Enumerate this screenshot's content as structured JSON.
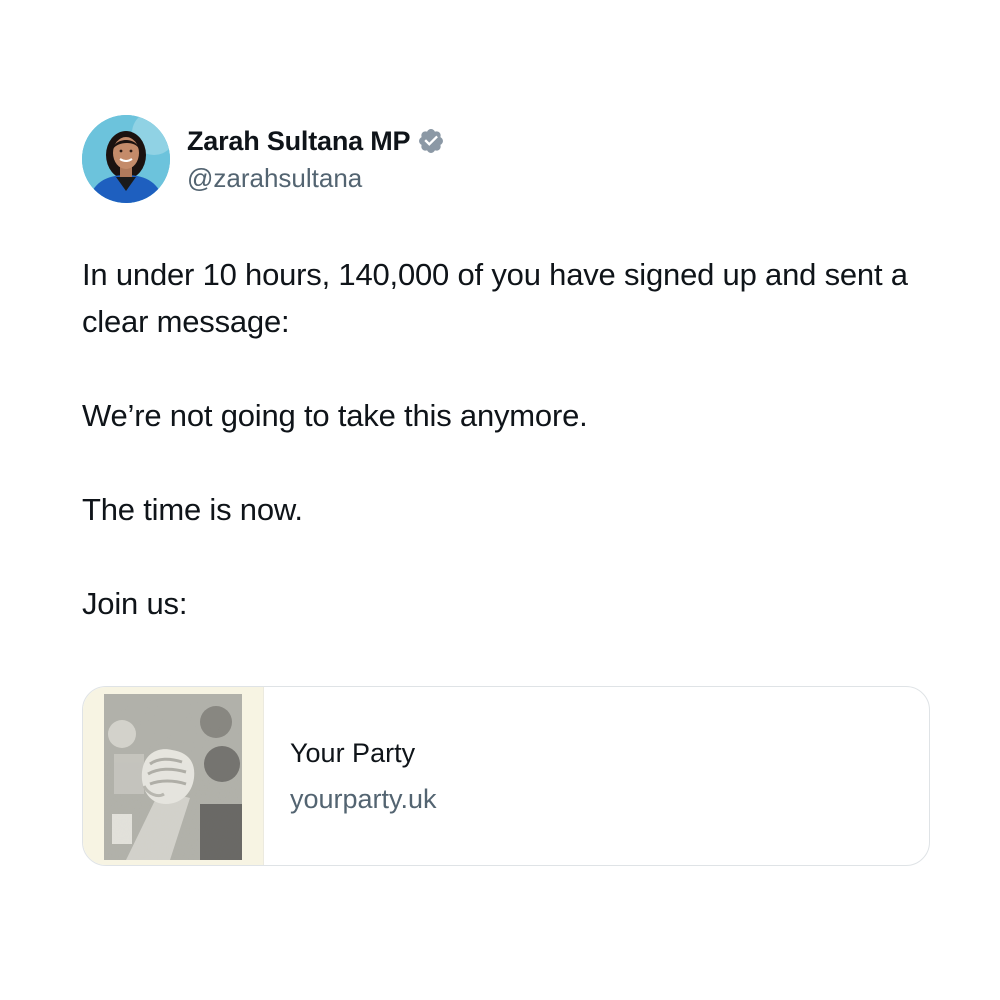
{
  "author": {
    "display_name": "Zarah Sultana MP",
    "handle": "@zarahsultana",
    "verified": true,
    "verified_icon": "verified-badge-icon",
    "verified_color": "#8b98a5"
  },
  "tweet": {
    "paragraphs": [
      "In under 10 hours, 140,000 of you have signed up and sent a clear message:",
      "We’re not going to take this anymore.",
      "The time is now.",
      "Join us:"
    ]
  },
  "link_card": {
    "title": "Your Party",
    "domain": "yourparty.uk",
    "thumbnail": "raised-fist-photo"
  },
  "colors": {
    "text_primary": "#0f1419",
    "text_secondary": "#536471",
    "card_border": "#dfe3e6",
    "thumb_background": "#f7f4e3"
  }
}
